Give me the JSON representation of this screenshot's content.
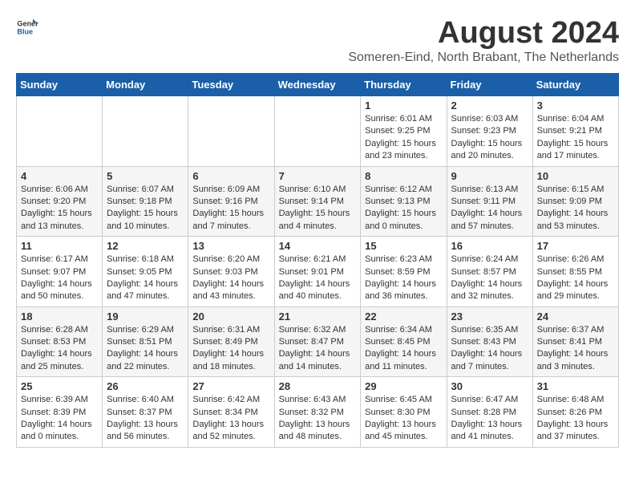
{
  "logo": {
    "text_general": "General",
    "text_blue": "Blue"
  },
  "header": {
    "month_year": "August 2024",
    "location": "Someren-Eind, North Brabant, The Netherlands"
  },
  "weekdays": [
    "Sunday",
    "Monday",
    "Tuesday",
    "Wednesday",
    "Thursday",
    "Friday",
    "Saturday"
  ],
  "weeks": [
    [
      {
        "day": "",
        "info": ""
      },
      {
        "day": "",
        "info": ""
      },
      {
        "day": "",
        "info": ""
      },
      {
        "day": "",
        "info": ""
      },
      {
        "day": "1",
        "info": "Sunrise: 6:01 AM\nSunset: 9:25 PM\nDaylight: 15 hours\nand 23 minutes."
      },
      {
        "day": "2",
        "info": "Sunrise: 6:03 AM\nSunset: 9:23 PM\nDaylight: 15 hours\nand 20 minutes."
      },
      {
        "day": "3",
        "info": "Sunrise: 6:04 AM\nSunset: 9:21 PM\nDaylight: 15 hours\nand 17 minutes."
      }
    ],
    [
      {
        "day": "4",
        "info": "Sunrise: 6:06 AM\nSunset: 9:20 PM\nDaylight: 15 hours\nand 13 minutes."
      },
      {
        "day": "5",
        "info": "Sunrise: 6:07 AM\nSunset: 9:18 PM\nDaylight: 15 hours\nand 10 minutes."
      },
      {
        "day": "6",
        "info": "Sunrise: 6:09 AM\nSunset: 9:16 PM\nDaylight: 15 hours\nand 7 minutes."
      },
      {
        "day": "7",
        "info": "Sunrise: 6:10 AM\nSunset: 9:14 PM\nDaylight: 15 hours\nand 4 minutes."
      },
      {
        "day": "8",
        "info": "Sunrise: 6:12 AM\nSunset: 9:13 PM\nDaylight: 15 hours\nand 0 minutes."
      },
      {
        "day": "9",
        "info": "Sunrise: 6:13 AM\nSunset: 9:11 PM\nDaylight: 14 hours\nand 57 minutes."
      },
      {
        "day": "10",
        "info": "Sunrise: 6:15 AM\nSunset: 9:09 PM\nDaylight: 14 hours\nand 53 minutes."
      }
    ],
    [
      {
        "day": "11",
        "info": "Sunrise: 6:17 AM\nSunset: 9:07 PM\nDaylight: 14 hours\nand 50 minutes."
      },
      {
        "day": "12",
        "info": "Sunrise: 6:18 AM\nSunset: 9:05 PM\nDaylight: 14 hours\nand 47 minutes."
      },
      {
        "day": "13",
        "info": "Sunrise: 6:20 AM\nSunset: 9:03 PM\nDaylight: 14 hours\nand 43 minutes."
      },
      {
        "day": "14",
        "info": "Sunrise: 6:21 AM\nSunset: 9:01 PM\nDaylight: 14 hours\nand 40 minutes."
      },
      {
        "day": "15",
        "info": "Sunrise: 6:23 AM\nSunset: 8:59 PM\nDaylight: 14 hours\nand 36 minutes."
      },
      {
        "day": "16",
        "info": "Sunrise: 6:24 AM\nSunset: 8:57 PM\nDaylight: 14 hours\nand 32 minutes."
      },
      {
        "day": "17",
        "info": "Sunrise: 6:26 AM\nSunset: 8:55 PM\nDaylight: 14 hours\nand 29 minutes."
      }
    ],
    [
      {
        "day": "18",
        "info": "Sunrise: 6:28 AM\nSunset: 8:53 PM\nDaylight: 14 hours\nand 25 minutes."
      },
      {
        "day": "19",
        "info": "Sunrise: 6:29 AM\nSunset: 8:51 PM\nDaylight: 14 hours\nand 22 minutes."
      },
      {
        "day": "20",
        "info": "Sunrise: 6:31 AM\nSunset: 8:49 PM\nDaylight: 14 hours\nand 18 minutes."
      },
      {
        "day": "21",
        "info": "Sunrise: 6:32 AM\nSunset: 8:47 PM\nDaylight: 14 hours\nand 14 minutes."
      },
      {
        "day": "22",
        "info": "Sunrise: 6:34 AM\nSunset: 8:45 PM\nDaylight: 14 hours\nand 11 minutes."
      },
      {
        "day": "23",
        "info": "Sunrise: 6:35 AM\nSunset: 8:43 PM\nDaylight: 14 hours\nand 7 minutes."
      },
      {
        "day": "24",
        "info": "Sunrise: 6:37 AM\nSunset: 8:41 PM\nDaylight: 14 hours\nand 3 minutes."
      }
    ],
    [
      {
        "day": "25",
        "info": "Sunrise: 6:39 AM\nSunset: 8:39 PM\nDaylight: 14 hours\nand 0 minutes."
      },
      {
        "day": "26",
        "info": "Sunrise: 6:40 AM\nSunset: 8:37 PM\nDaylight: 13 hours\nand 56 minutes."
      },
      {
        "day": "27",
        "info": "Sunrise: 6:42 AM\nSunset: 8:34 PM\nDaylight: 13 hours\nand 52 minutes."
      },
      {
        "day": "28",
        "info": "Sunrise: 6:43 AM\nSunset: 8:32 PM\nDaylight: 13 hours\nand 48 minutes."
      },
      {
        "day": "29",
        "info": "Sunrise: 6:45 AM\nSunset: 8:30 PM\nDaylight: 13 hours\nand 45 minutes."
      },
      {
        "day": "30",
        "info": "Sunrise: 6:47 AM\nSunset: 8:28 PM\nDaylight: 13 hours\nand 41 minutes."
      },
      {
        "day": "31",
        "info": "Sunrise: 6:48 AM\nSunset: 8:26 PM\nDaylight: 13 hours\nand 37 minutes."
      }
    ]
  ]
}
